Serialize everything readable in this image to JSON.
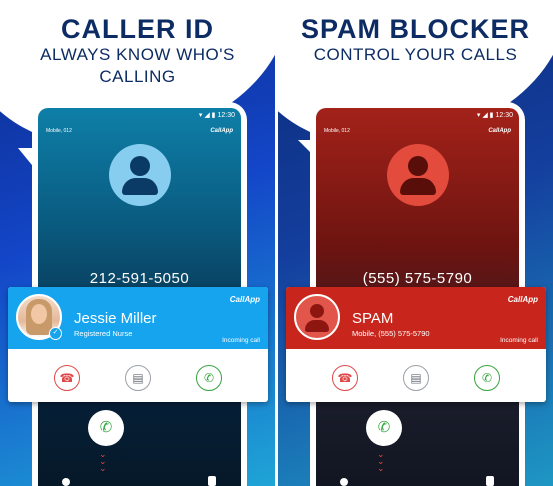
{
  "left": {
    "title": "CALLER ID",
    "subtitle_line1": "ALWAYS KNOW WHO'S",
    "subtitle_line2": "CALLING",
    "status_time": "12:30",
    "sim_label": "Mobile, 012",
    "brand": "CallApp",
    "number": "212-591-5050",
    "card": {
      "name": "Jessie Miller",
      "subtitle": "Registered Nurse",
      "brand": "CallApp",
      "incoming": "Incoming call"
    }
  },
  "right": {
    "title": "SPAM BLOCKER",
    "subtitle": "CONTROL YOUR CALLS",
    "status_time": "12:30",
    "sim_label": "Mobile, 012",
    "brand": "CallApp",
    "number": "(555) 575-5790",
    "card": {
      "name": "SPAM",
      "subtitle": "Mobile, (555) 575-5790",
      "brand": "CallApp",
      "incoming": "Incoming call"
    }
  },
  "icons": {
    "decline": "hangup-icon",
    "message": "message-icon",
    "answer": "phone-icon"
  },
  "colors": {
    "caller_card": "#16a4ee",
    "spam_card": "#c8261c",
    "title_text": "#0c2c63",
    "answer_green": "#35a840",
    "decline_red": "#e04848"
  }
}
